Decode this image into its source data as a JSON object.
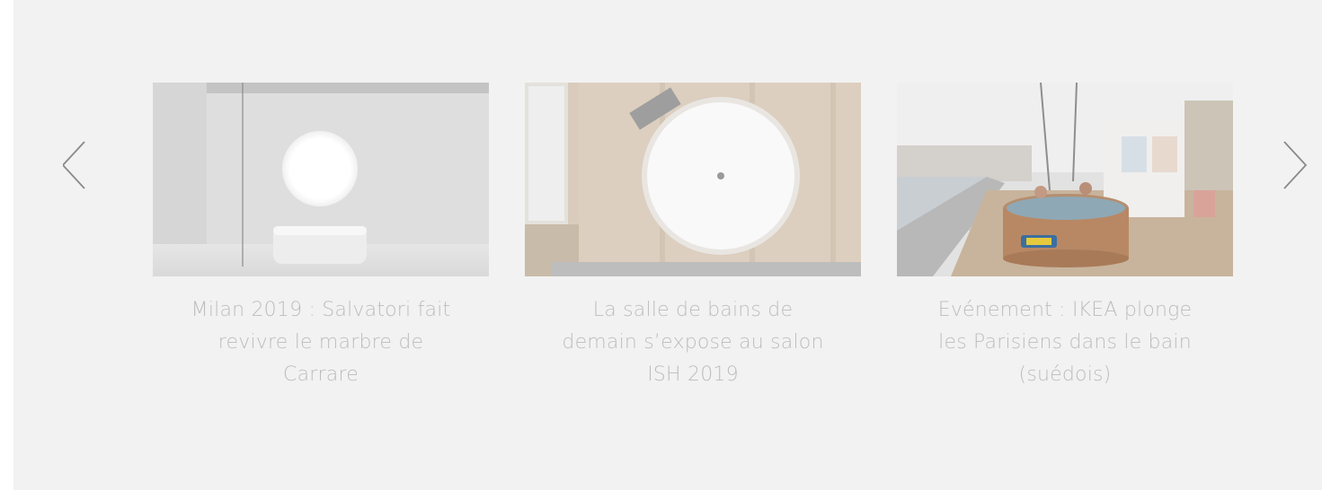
{
  "carousel": {
    "prev_icon": "chevron-left-icon",
    "next_icon": "chevron-right-icon",
    "items": [
      {
        "title": "Milan 2019 : Salvatori fait revivre le marbre de Carrare",
        "image": "white-marble-bathroom-with-round-window"
      },
      {
        "title": "La salle de bains de demain s’expose au salon ISH 2019",
        "image": "round-white-washbasin-top-view"
      },
      {
        "title": "Evénement : IKEA plonge les Parisiens dans le bain (suédois)",
        "image": "wooden-hot-tub-on-paris-riverbank"
      }
    ]
  },
  "colors": {
    "panel_background": "#f2f2f2",
    "caption_text": "#bdbdbd",
    "arrow_stroke": "#8a8a8a"
  }
}
